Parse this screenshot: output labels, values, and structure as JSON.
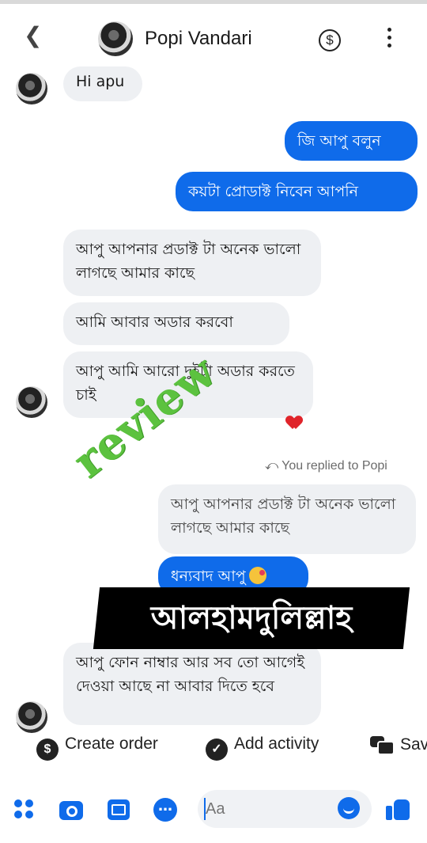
{
  "header": {
    "back_icon": "chevron-left-icon",
    "contact_name": "Popi Vandari",
    "currency_icon": "dollar-circle-icon",
    "menu_icon": "kebab-menu-icon"
  },
  "messages": [
    {
      "from": "them",
      "text": "Hi apu"
    },
    {
      "from": "me",
      "text": "জি আপু বলুন"
    },
    {
      "from": "me",
      "text": "কয়টা প্রোডাক্ট নিবেন আপনি"
    },
    {
      "from": "them",
      "text": "আপু আপনার প্রডাক্ট টা অনেক ভালো লাগছে আমার কাছে"
    },
    {
      "from": "them",
      "text": "আমি আবার অডার করবো"
    },
    {
      "from": "them",
      "text": "আপু আমি আরো দুইটা অডার করতে চাই",
      "reaction": "heart-reaction-icon"
    },
    {
      "from": "me",
      "replied_label": "You replied to Popi",
      "quoted": "আপু আপনার প্রডাক্ট টা অনেক ভালো লাগছে আমার কাছে",
      "text": "ধন্যবাদ আপু",
      "emoji": "smiling-face-with-hearts-icon"
    },
    {
      "from": "them",
      "text": "আপু ফোন নাম্বার আর সব তো আগেই দেওয়া আছে না আবার দিতে হবে"
    }
  ],
  "overlays": {
    "stamp_text": "review",
    "banner_text": "আলহামদুলিল্লাহ"
  },
  "actions": [
    {
      "label": "Create order",
      "icon": "dollar-circle-icon"
    },
    {
      "label": "Add activity",
      "icon": "check-circle-icon"
    },
    {
      "label": "Save",
      "icon": "chat-bubbles-icon"
    }
  ],
  "composer": {
    "placeholder": "Aa"
  },
  "colors": {
    "outgoing": "#0f6bea",
    "incoming": "#eef0f3",
    "stamp": "#5cc23f",
    "banner": "#000000"
  }
}
